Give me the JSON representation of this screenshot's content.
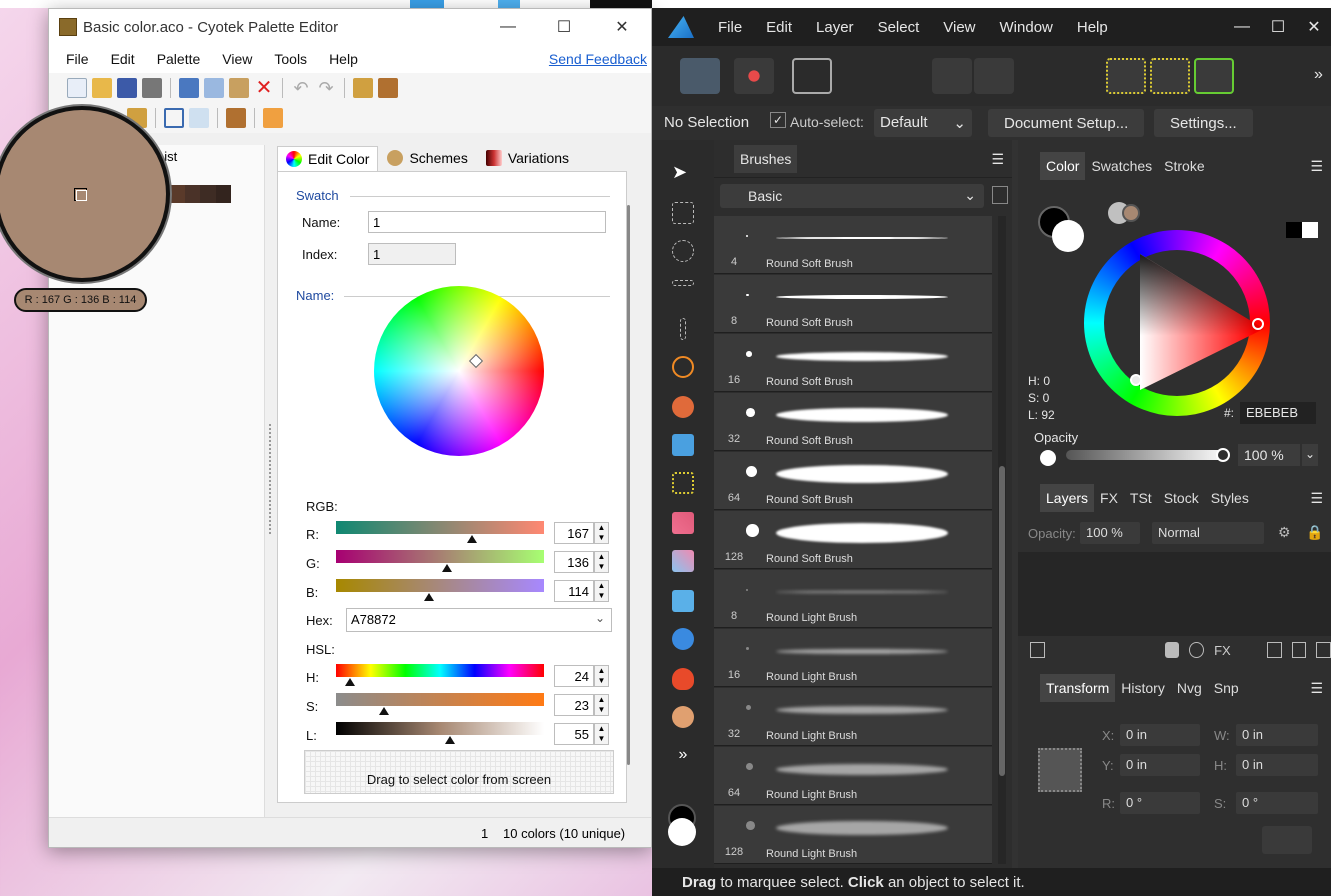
{
  "cyotek": {
    "title": "Basic color.aco - Cyotek Palette Editor",
    "menu": [
      "File",
      "Edit",
      "Palette",
      "View",
      "Tools",
      "Help"
    ],
    "send_feedback": "Send Feedback",
    "list_tab": "List",
    "tabs": [
      "Edit Color",
      "Schemes",
      "Variations"
    ],
    "swatch_group": "Swatch",
    "name_label": "Name:",
    "name_value": "1",
    "index_label": "Index:",
    "index_value": "1",
    "name_group": "Name:",
    "rgb_label": "RGB:",
    "r_label": "R:",
    "g_label": "G:",
    "b_label": "B:",
    "r_value": "167",
    "g_value": "136",
    "b_value": "114",
    "hex_label": "Hex:",
    "hex_value": "A78872",
    "hsl_label": "HSL:",
    "h_label": "H:",
    "s_label": "S:",
    "l_label": "L:",
    "h_value": "24",
    "s_value": "23",
    "l_value": "55",
    "drag_text": "Drag to select color from screen",
    "status_index": "1",
    "status_colors": "10 colors (10 unique)",
    "magnifier_tip": "R : 167 G : 136 B : 114",
    "sample_color": "#A78872",
    "slider_levels": {
      "r": 0.655,
      "g": 0.533,
      "b": 0.447,
      "h": 0.067,
      "s": 0.23,
      "l": 0.55
    }
  },
  "affinity": {
    "menu": [
      "File",
      "Edit",
      "Layer",
      "Select",
      "View",
      "Window",
      "Help"
    ],
    "no_selection": "No Selection",
    "auto_select_label": "Auto-select:",
    "auto_select_value": "Default",
    "document_setup": "Document Setup...",
    "settings": "Settings...",
    "brushes_tab": "Brushes",
    "brush_category": "Basic",
    "brushes": [
      {
        "size": "4",
        "name": "Round Soft Brush"
      },
      {
        "size": "8",
        "name": "Round Soft Brush"
      },
      {
        "size": "16",
        "name": "Round Soft Brush"
      },
      {
        "size": "32",
        "name": "Round Soft Brush"
      },
      {
        "size": "64",
        "name": "Round Soft Brush"
      },
      {
        "size": "128",
        "name": "Round Soft Brush"
      },
      {
        "size": "8",
        "name": "Round Light Brush"
      },
      {
        "size": "16",
        "name": "Round Light Brush"
      },
      {
        "size": "32",
        "name": "Round Light Brush"
      },
      {
        "size": "64",
        "name": "Round Light Brush"
      },
      {
        "size": "128",
        "name": "Round Light Brush"
      }
    ],
    "color_tabs": [
      "Color",
      "Swatches",
      "Stroke"
    ],
    "h": "H: 0",
    "s": "S: 0",
    "l": "L: 92",
    "hex_prefix": "#:",
    "hex_value": "EBEBEB",
    "opacity_label": "Opacity",
    "opacity_value": "100 %",
    "layers_tabs": [
      "Layers",
      "FX",
      "TSt",
      "Stock",
      "Styles"
    ],
    "layers_opacity_label": "Opacity:",
    "layers_opacity_value": "100 %",
    "blend_mode": "Normal",
    "transform_tabs": [
      "Transform",
      "History",
      "Nvg",
      "Snp"
    ],
    "x_label": "X:",
    "x_value": "0 in",
    "y_label": "Y:",
    "y_value": "0 in",
    "w_label": "W:",
    "w_value": "0 in",
    "h_label": "H:",
    "h_value": "0 in",
    "r_label": "R:",
    "r_value": "0 °",
    "s_label": "S:",
    "s_value": "0 °",
    "status_drag": "Drag",
    "status_mid": " to marquee select. ",
    "status_click": "Click",
    "status_end": " an object to select it."
  }
}
